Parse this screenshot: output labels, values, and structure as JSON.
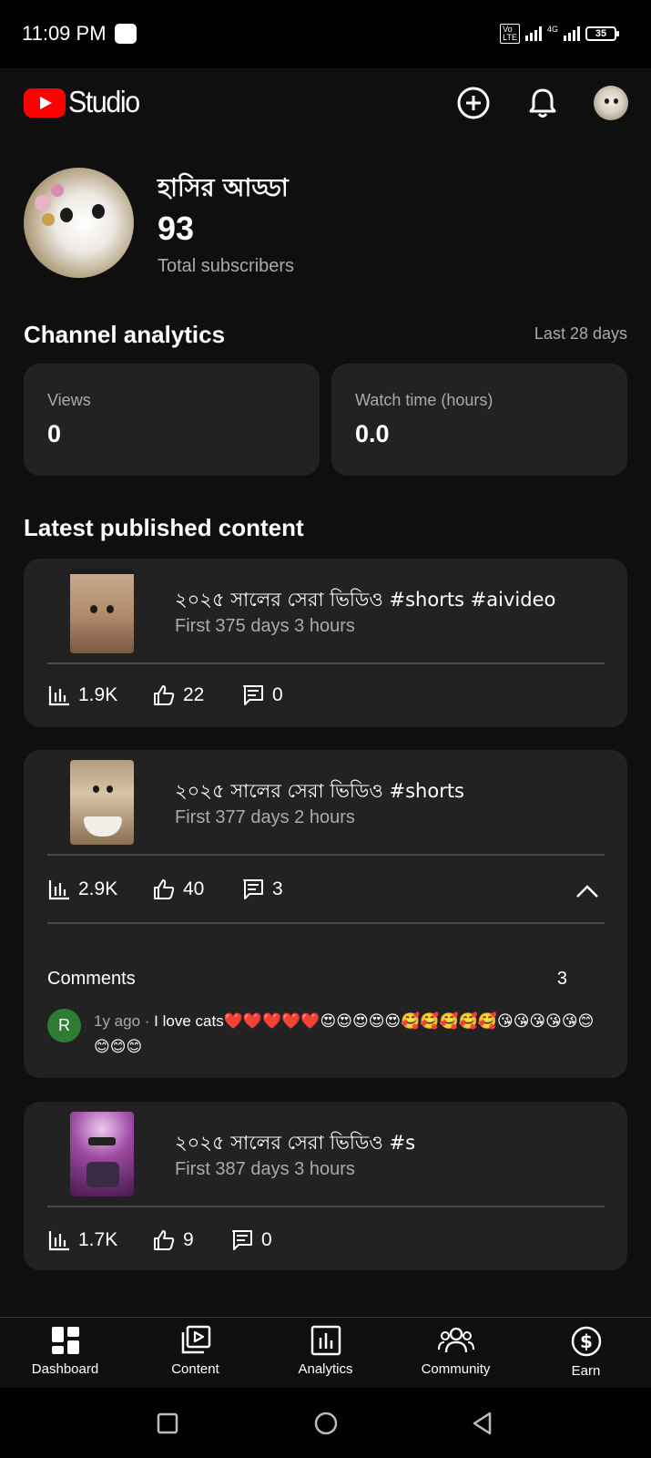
{
  "status_bar": {
    "time": "11:09 PM",
    "volte": "Vo LTE",
    "network": "4G",
    "battery": "35"
  },
  "header": {
    "logo_text": "Studio",
    "icons": [
      "create-icon",
      "notifications-icon",
      "account-avatar"
    ]
  },
  "channel": {
    "name": "হাসির আড্ডা",
    "subscriber_count": "93",
    "subscriber_label": "Total subscribers"
  },
  "analytics": {
    "title": "Channel analytics",
    "range": "Last 28 days",
    "cards": [
      {
        "label": "Views",
        "value": "0"
      },
      {
        "label": "Watch time (hours)",
        "value": "0.0"
      }
    ]
  },
  "latest": {
    "title": "Latest published content",
    "items": [
      {
        "title": "২০২৫ সালের সেরা ভিডিও #shorts #aivideo",
        "age": "First 375 days 3 hours",
        "views": "1.9K",
        "likes": "22",
        "comments": "0"
      },
      {
        "title": "২০২৫ সালের সেরা ভিডিও #shorts",
        "age": "First 377 days 2 hours",
        "views": "2.9K",
        "likes": "40",
        "comments": "3",
        "comments_section": {
          "label": "Comments",
          "count": "3",
          "latest": {
            "avatar_letter": "R",
            "time": "1y ago",
            "separator": " · ",
            "text": "I love cats❤️❤️❤️❤️❤️😍😍😍😍😍🥰🥰🥰🥰🥰😘😘😘😘😘😊😊😊😊"
          }
        }
      },
      {
        "title": "২০২৫ সালের সেরা ভিডিও #s",
        "age": "First 387 days 3 hours",
        "views": "1.7K",
        "likes": "9",
        "comments": "0"
      }
    ]
  },
  "bottom_nav": {
    "items": [
      {
        "label": "Dashboard",
        "icon": "dashboard-icon",
        "active": true
      },
      {
        "label": "Content",
        "icon": "content-icon"
      },
      {
        "label": "Analytics",
        "icon": "analytics-icon"
      },
      {
        "label": "Community",
        "icon": "community-icon"
      },
      {
        "label": "Earn",
        "icon": "earn-icon"
      }
    ]
  },
  "colors": {
    "background": "#0f0f0f",
    "card": "#222222",
    "brand_red": "#ff0000",
    "muted_text": "#aaaaaa",
    "commenter_avatar": "#2f7d32"
  }
}
